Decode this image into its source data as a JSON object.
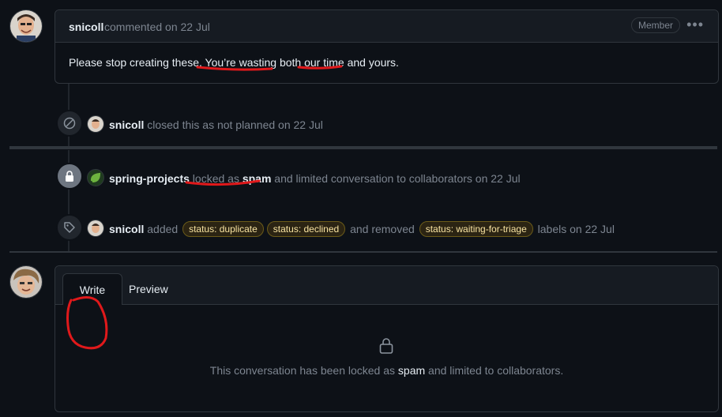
{
  "comment": {
    "author": "snicoll",
    "meta": "commented on 22 Jul",
    "role_badge": "Member",
    "menu_glyph": "•••",
    "body": {
      "p1": "Please stop creating these. ",
      "u1": "You’re wasting",
      "p2": " both ",
      "u2": "our time",
      "p3": " and yours."
    }
  },
  "events": {
    "closed": {
      "actor": "snicoll",
      "text": "closed this as not planned on 22 Jul"
    },
    "locked": {
      "actor": "spring-projects",
      "locked_as": "locked as ",
      "reason": "spam",
      "rest": " and limited conversation to collaborators on 22 Jul"
    },
    "labeled": {
      "actor": "snicoll",
      "added": "added",
      "labels_added": [
        "status: duplicate",
        "status: declined"
      ],
      "and_removed": "and removed",
      "labels_removed": [
        "status: waiting-for-triage"
      ],
      "suffix": "labels on 22 Jul"
    }
  },
  "editor": {
    "tab_write": "Write",
    "tab_preview": "Preview",
    "locked_msg_1": "This conversation has been locked as ",
    "locked_reason": "spam",
    "locked_msg_2": " and limited to collaborators."
  },
  "colors": {
    "background": "#0d1117",
    "border": "#30363d",
    "label_bg": "#2b2413",
    "label_text": "#f8e3a1",
    "annotation_red": "#e0191b"
  },
  "icons": [
    "avatar-snicoll",
    "skip-circle-icon",
    "lock-icon",
    "spring-logo-icon",
    "tag-icon",
    "kebab-icon",
    "avatar-current-user"
  ]
}
